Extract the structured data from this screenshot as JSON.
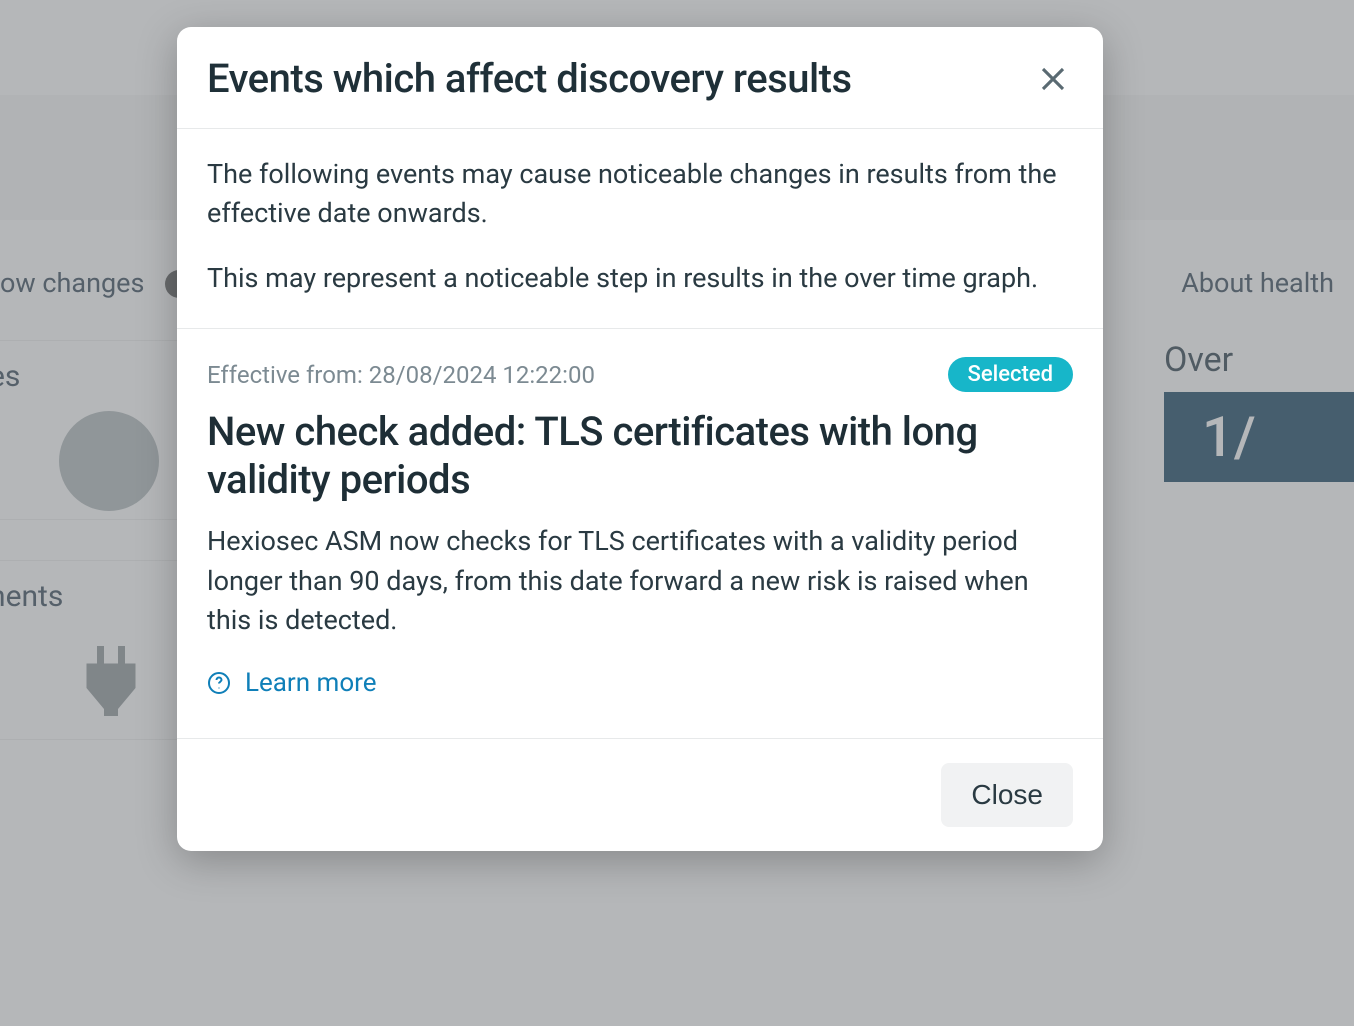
{
  "background": {
    "row1_left": "ow changes",
    "row1_right": "About health",
    "card1_label": "es",
    "card2_label": "nents",
    "rightpanel_label": "Over",
    "score_prefix": "1/"
  },
  "modal": {
    "title": "Events which affect discovery results",
    "intro_p1": "The following events may cause noticeable changes in results from the effective date onwards.",
    "intro_p2": "This may represent a noticeable step in results in the over time graph.",
    "event": {
      "effective_label": "Effective from:",
      "effective_value": "28/08/2024 12:22:00",
      "badge": "Selected",
      "title": "New check added: TLS certificates with long validity periods",
      "description": "Hexiosec ASM now checks for TLS certificates with a validity period longer than 90 days, from this date forward a new risk is raised when this is detected.",
      "learn_more": "Learn more"
    },
    "close_button": "Close"
  }
}
